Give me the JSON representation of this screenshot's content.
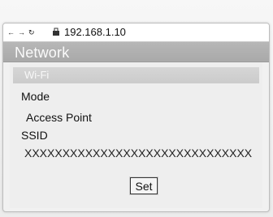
{
  "browser": {
    "back_icon": "←",
    "forward_icon": "→",
    "reload_icon": "↻",
    "url": "192.168.1.10"
  },
  "page": {
    "title": "Network"
  },
  "wifi": {
    "section_label": "Wi-Fi",
    "mode_label": "Mode",
    "mode_value": "Access Point",
    "ssid_label": "SSID",
    "ssid_value": "XXXXXXXXXXXXXXXXXXXXXXXXXXXXXX",
    "set_label": "Set"
  }
}
